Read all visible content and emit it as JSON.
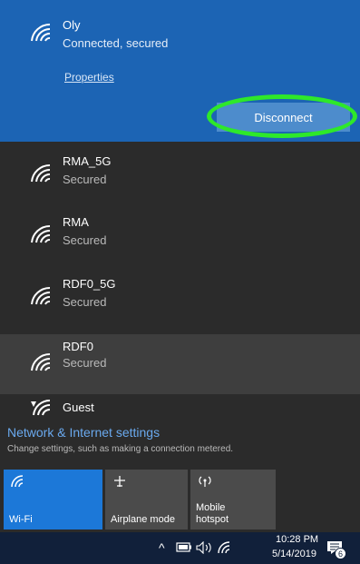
{
  "connected_network": {
    "ssid": "Oly",
    "status": "Connected, secured",
    "properties_label": "Properties",
    "disconnect_label": "Disconnect"
  },
  "networks": [
    {
      "ssid": "RMA_5G",
      "status": "Secured"
    },
    {
      "ssid": "RMA",
      "status": "Secured"
    },
    {
      "ssid": "RDF0_5G",
      "status": "Secured"
    },
    {
      "ssid": "RDF0",
      "status": "Secured"
    }
  ],
  "guest": {
    "label": "Guest"
  },
  "settings": {
    "link": "Network & Internet settings",
    "description": "Change settings, such as making a connection metered."
  },
  "quick_actions": [
    {
      "label": "Wi-Fi",
      "icon": "wifi-icon",
      "active": true
    },
    {
      "label": "Airplane mode",
      "icon": "airplane-icon",
      "active": false
    },
    {
      "label_line1": "Mobile",
      "label_line2": "hotspot",
      "icon": "hotspot-icon",
      "active": false
    }
  ],
  "taskbar": {
    "time": "10:28 PM",
    "date": "5/14/2019",
    "notification_count": "6"
  },
  "colors": {
    "accent": "#1c64b4",
    "highlight_ring": "#2ee82a",
    "panel": "#2b2b2b",
    "link": "#6aa9ee"
  }
}
